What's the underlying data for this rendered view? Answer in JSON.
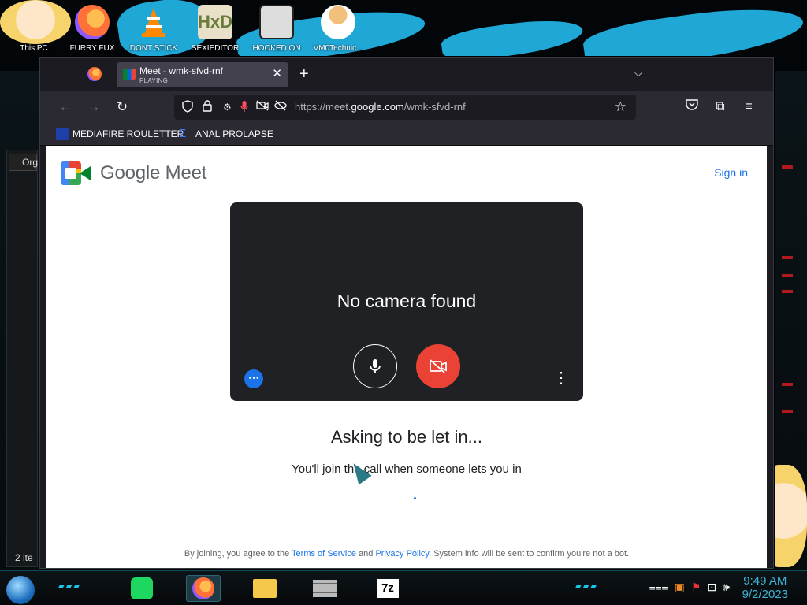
{
  "desktop": {
    "icons": [
      {
        "label": "This PC"
      },
      {
        "label": "FURRY FUX"
      },
      {
        "label": "DONT STICK"
      },
      {
        "label": "SEXIEDITOR"
      },
      {
        "label": "HOOKED ON"
      },
      {
        "label": "VM0Technic..."
      }
    ],
    "explorer": {
      "organize": "Org",
      "item_count": "2 ite"
    }
  },
  "browser": {
    "tab": {
      "title": "Meet - wmk-sfvd-rnf",
      "status": "PLAYING"
    },
    "url": {
      "prefix": "https://meet.",
      "host": "google.com",
      "path": "/wmk-sfvd-rnf"
    },
    "bookmarks": [
      {
        "label": "MEDIAFIRE ROULETTER"
      },
      {
        "label": "ANAL PROLAPSE"
      }
    ]
  },
  "meet": {
    "logo_text": "Google Meet",
    "sign_in": "Sign in",
    "preview_message": "No camera found",
    "status_title": "Asking to be let in...",
    "status_subtitle": "You'll join the call when someone lets you in",
    "footer": {
      "prefix": "By joining, you agree to the",
      "terms": "Terms of Service",
      "and": "and",
      "privacy": "Privacy Policy",
      "suffix": ". System info will be sent to confirm you're not a bot."
    }
  },
  "taskbar": {
    "apps": [
      "spotify",
      "firefox",
      "file-explorer",
      "firewall",
      "7-zip"
    ],
    "sevenzip_label": "7z",
    "time": "9:49 AM",
    "date": "9/2/2023"
  }
}
